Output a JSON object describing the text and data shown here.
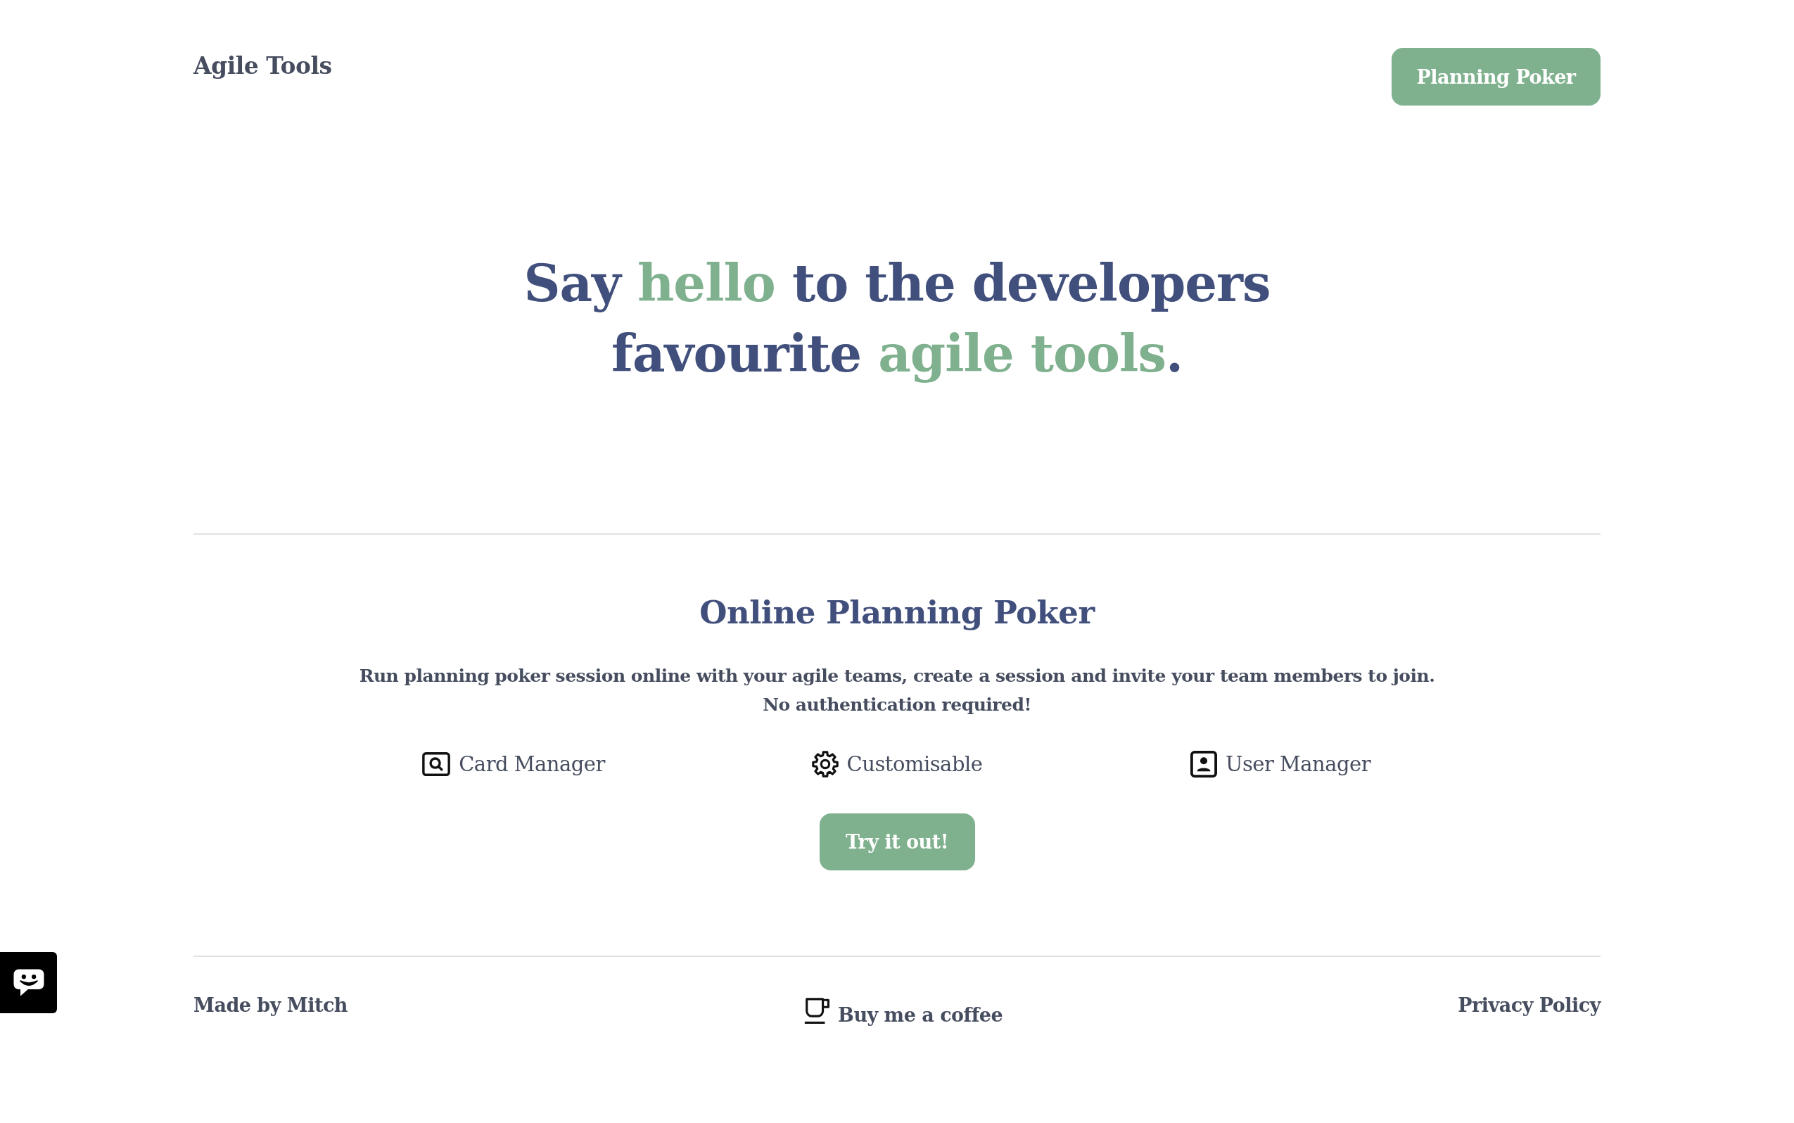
{
  "header": {
    "logo": "Agile Tools",
    "nav_button": "Planning Poker"
  },
  "hero": {
    "headline_lines": [
      [
        {
          "text": "Say ",
          "accent": false
        },
        {
          "text": "hello",
          "accent": true
        },
        {
          "text": " to the developers",
          "accent": false
        }
      ],
      [
        {
          "text": "favourite ",
          "accent": false
        },
        {
          "text": "agile tools",
          "accent": true
        },
        {
          "text": ".",
          "accent": false
        }
      ]
    ]
  },
  "product": {
    "title": "Online Planning Poker",
    "description": "Run planning poker session online with your agile teams, create a session and invite your team members to join.\nNo authentication required!",
    "features": [
      {
        "kind": "cards",
        "label": "Card Manager"
      },
      {
        "kind": "settings",
        "label": "Customisable"
      },
      {
        "kind": "users",
        "label": "User Manager"
      }
    ],
    "cta_button": "Try it out!"
  },
  "footer": {
    "author_link": "Made by Mitch",
    "coffee_link": "Buy me a coffee",
    "privacy_link": "Privacy Policy"
  }
}
